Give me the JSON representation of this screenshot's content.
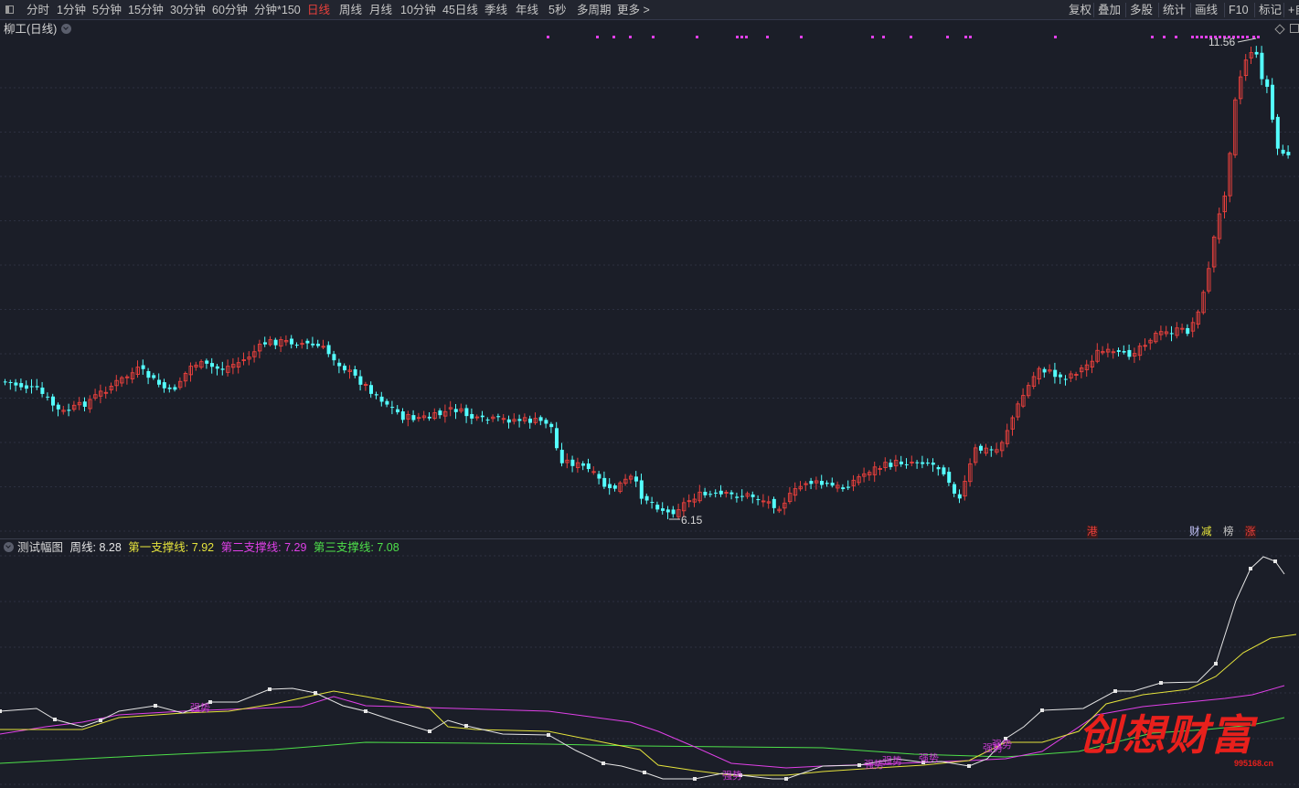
{
  "toolbar": {
    "left_items": [
      "分时",
      "1分钟",
      "5分钟",
      "15分钟",
      "30分钟",
      "60分钟",
      "分钟*150",
      "日线",
      "周线",
      "月线",
      "10分钟",
      "45日线",
      "季线",
      "年线",
      "5秒",
      "多周期",
      "更多 >"
    ],
    "active_item": "日线",
    "right_items": [
      "复权",
      "叠加",
      "多股",
      "统计",
      "画线",
      "F10",
      "标记",
      "+自"
    ]
  },
  "main_panel": {
    "title": "柳工(日线)",
    "high_label": "11.56",
    "low_label": "6.15"
  },
  "badges": {
    "gang": "港",
    "cai": "财",
    "jian": "减",
    "bang": "榜",
    "zhang": "涨"
  },
  "indicator": {
    "name": "测试幅图",
    "weekly_label": "周线:",
    "weekly_value": "8.28",
    "s1_label": "第一支撑线:",
    "s1_value": "7.92",
    "s2_label": "第二支撑线:",
    "s2_value": "7.29",
    "s3_label": "第三支撑线:",
    "s3_value": "7.08",
    "signal_text": "强势"
  },
  "colors": {
    "up": "#e8403c",
    "down": "#54ffff",
    "weekly": "#e6e6e6",
    "s1": "#e5e33c",
    "s2": "#e040e8",
    "s3": "#4ee04a",
    "active_tab": "#e8403c"
  },
  "watermark": {
    "text": "创想财富",
    "url": "995168.cn"
  }
}
